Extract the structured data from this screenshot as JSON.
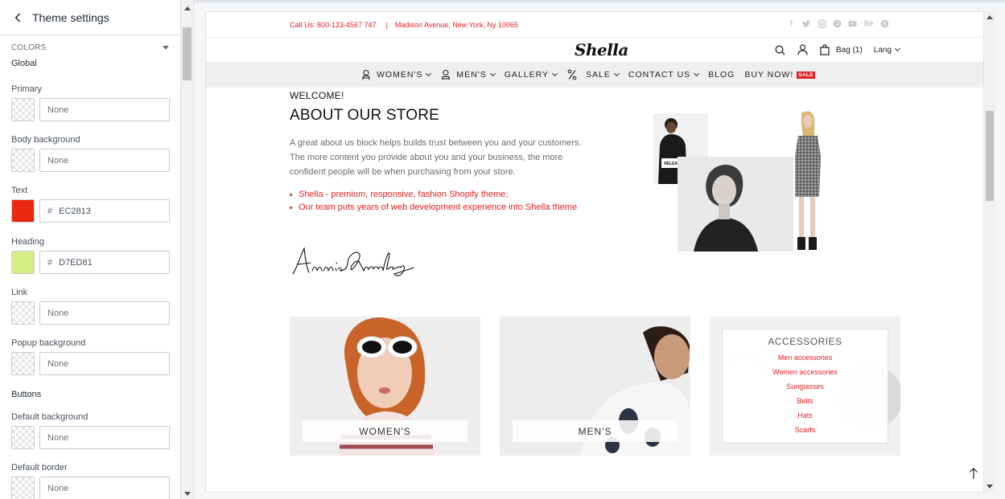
{
  "panel": {
    "title": "Theme settings",
    "section": "COLORS",
    "global_title": "Global",
    "buttons_title": "Buttons",
    "fields": [
      {
        "label": "Primary",
        "value": "None",
        "color": null
      },
      {
        "label": "Body background",
        "value": "None",
        "color": null
      },
      {
        "label": "Text",
        "value": "EC2813",
        "color": "#EC2813"
      },
      {
        "label": "Heading",
        "value": "D7ED81",
        "color": "#D7ED81"
      },
      {
        "label": "Link",
        "value": "None",
        "color": null
      },
      {
        "label": "Popup background",
        "value": "None",
        "color": null
      },
      {
        "label": "Default background",
        "value": "None",
        "color": null
      },
      {
        "label": "Default border",
        "value": "None",
        "color": null
      }
    ],
    "hash": "#"
  },
  "store": {
    "contact": {
      "phone": "Call Us: 800-123-4567 747",
      "separator": "|",
      "address": "Madison Avenue, New York, Ny 10065"
    },
    "socials": [
      "facebook-icon",
      "twitter-icon",
      "instagram-icon",
      "pinterest-icon",
      "youtube-icon",
      "behance-icon",
      "skype-icon"
    ],
    "logo": "Shella",
    "bag": "Bag (1)",
    "lang": "Lang",
    "nav": [
      {
        "label": "WOMEN'S",
        "icon": "woman-icon",
        "dropdown": true
      },
      {
        "label": "MEN'S",
        "icon": "man-icon",
        "dropdown": true
      },
      {
        "label": "GALLERY",
        "icon": null,
        "dropdown": true
      },
      {
        "label": "SALE",
        "icon": "percent-icon",
        "dropdown": true
      },
      {
        "label": "CONTACT US",
        "icon": null,
        "dropdown": true
      },
      {
        "label": "BLOG",
        "icon": null,
        "dropdown": false
      },
      {
        "label": "BUY NOW!",
        "icon": null,
        "dropdown": false,
        "badge": "SALE"
      }
    ],
    "about": {
      "welcome": "WELCOME!",
      "title": "ABOUT OUR STORE",
      "text": "A great about us block helps builds trust between you and your customers. The more content you provide about you and your business, the more confident people will be when purchasing from your store.",
      "bullets": [
        "Shella - premium, responsive, fashion Shopify theme;",
        "Our team puts years of web development experience into Shella theme"
      ],
      "signature": "Annie Greenberg"
    },
    "categories": {
      "women": "WOMEN'S",
      "men": "MEN'S",
      "accessories": {
        "title": "ACCESSORIES",
        "links": [
          "Men accessories",
          "Women accessories",
          "Sunglasses",
          "Belts",
          "Hats",
          "Scarfs"
        ]
      }
    },
    "colors": {
      "accent": "#e02222",
      "nav_bg": "#efefef"
    }
  }
}
